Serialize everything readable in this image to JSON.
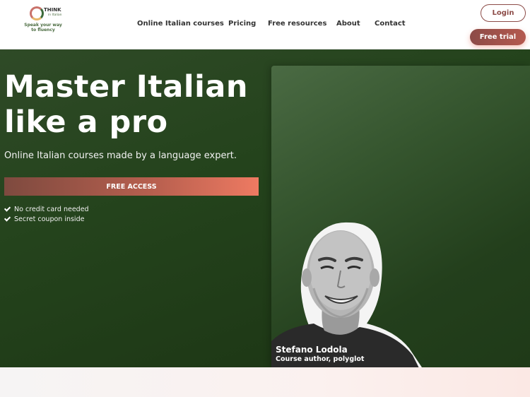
{
  "header": {
    "logo": {
      "brand_top": "THINK",
      "brand_sub": "in Italian",
      "tagline": "Speak your way to fluency"
    },
    "nav": [
      {
        "label": "Online Italian courses"
      },
      {
        "label": "Pricing"
      },
      {
        "label": "Free resources"
      },
      {
        "label": "About"
      },
      {
        "label": "Contact"
      }
    ],
    "login_label": "Login",
    "trial_label": "Free trial"
  },
  "hero": {
    "title_line1": "Master Italian",
    "title_line2": "like a pro",
    "subtitle": "Online Italian courses made by a language expert.",
    "cta_label": "FREE ACCESS",
    "checks": [
      {
        "label": "No credit card needed",
        "icon": "check-icon"
      },
      {
        "label": "Secret coupon inside",
        "icon": "check-icon"
      }
    ]
  },
  "author": {
    "name": "Stefano Lodola",
    "role": "Course author, polyglot"
  },
  "colors": {
    "brand": "#8c4b47",
    "hero_bg": "#24431c",
    "cta_end": "#ee7a62"
  }
}
